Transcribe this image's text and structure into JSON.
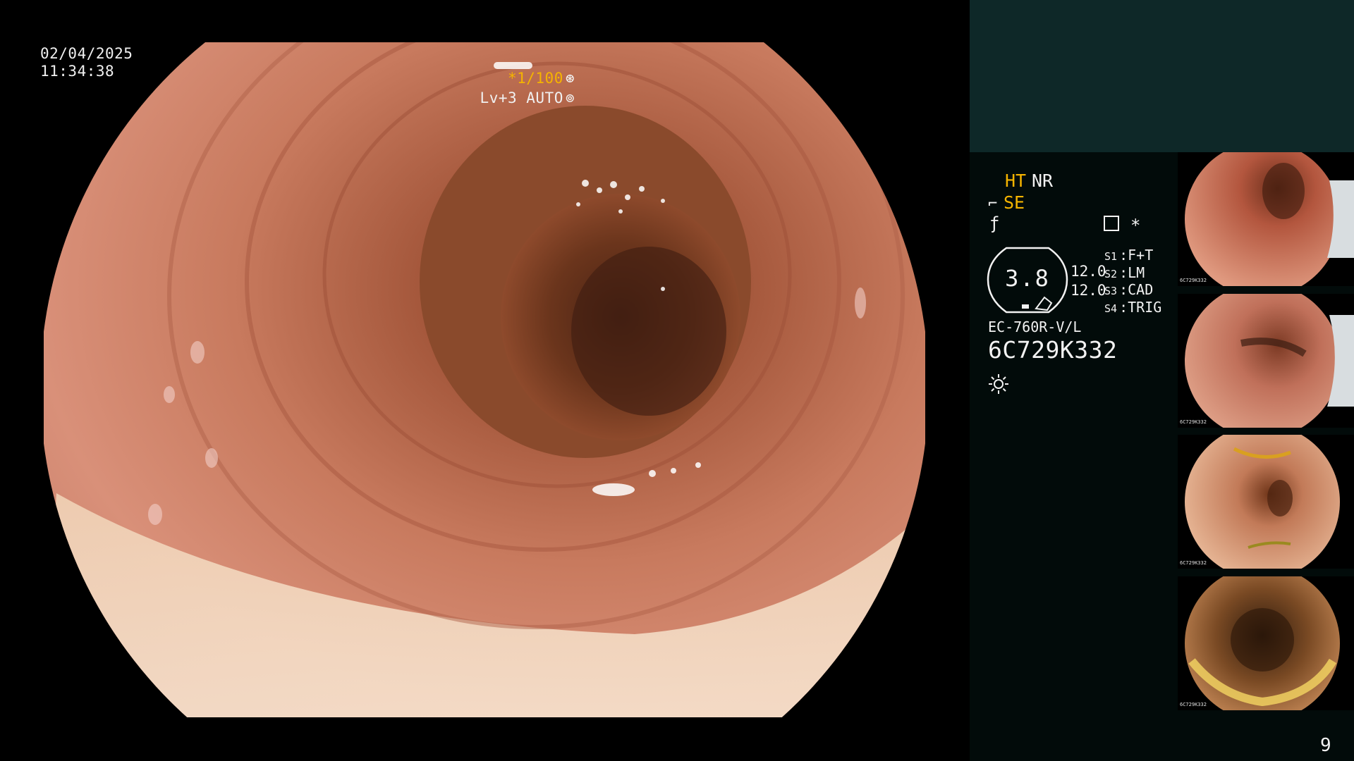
{
  "overlay": {
    "date": "02/04/2025",
    "time": "11:34:38",
    "shutter": "*1/100",
    "iris": "Lv+3 AUTO"
  },
  "panel": {
    "ht": "HT",
    "nr": "NR",
    "se": "SE",
    "gauge_value": "3.8",
    "param_1": "12.0",
    "param_2": "12.0",
    "switches": [
      {
        "key": "S1",
        "value": "F+T"
      },
      {
        "key": "S2",
        "value": "LM"
      },
      {
        "key": "S3",
        "value": "CAD"
      },
      {
        "key": "S4",
        "value": "TRIG"
      }
    ],
    "scope_model": "EC-760R-V/L",
    "scope_serial": "6C729K332",
    "page_number": "9",
    "thumbnail_label": "6C729K332"
  },
  "icons": [
    "flash-icon",
    "iris-icon",
    "scope-wire-icon",
    "f-icon",
    "memo-icon",
    "light-icon"
  ],
  "colors": {
    "accent_yellow": "#f5b400",
    "panel_bg": "#020b0a",
    "panel_top_bg": "#0e2828"
  }
}
